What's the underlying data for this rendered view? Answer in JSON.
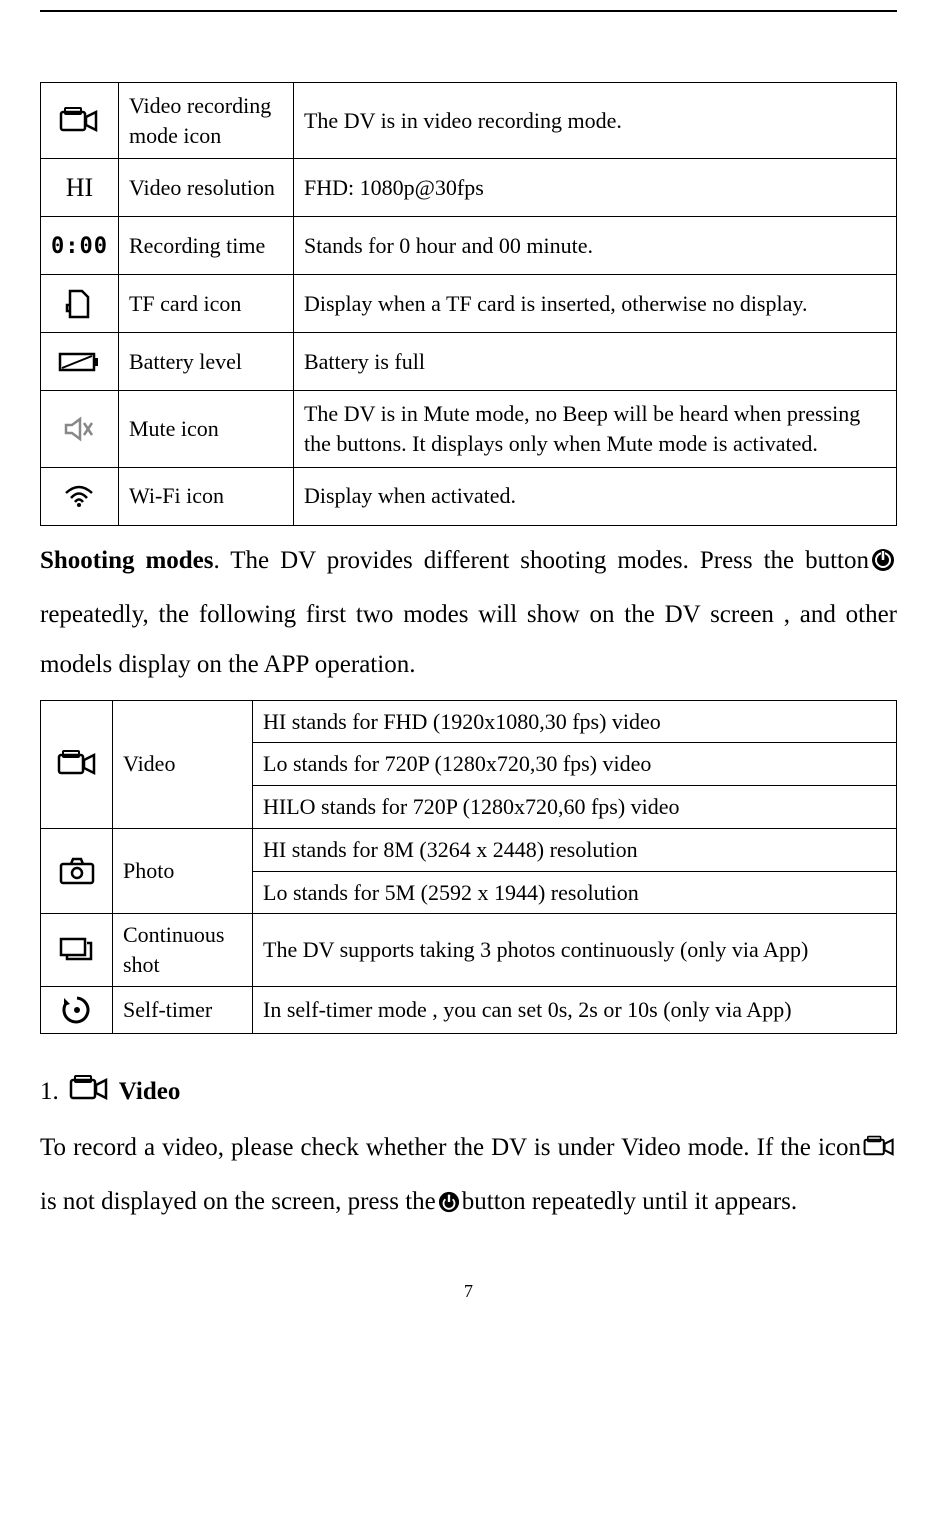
{
  "icons_table": {
    "rows": [
      {
        "name": "Video recording mode icon",
        "desc": "The DV is in video recording mode."
      },
      {
        "glyph": "HI",
        "name": "Video resolution",
        "desc": "FHD: 1080p@30fps"
      },
      {
        "glyph": "0:00",
        "name": "Recording time",
        "desc": "Stands for 0 hour and 00 minute."
      },
      {
        "name": "TF card icon",
        "desc": "Display when a TF card is inserted, otherwise no display."
      },
      {
        "name": "Battery level",
        "desc": "Battery is full"
      },
      {
        "name": "Mute icon",
        "desc": "The DV is in Mute mode, no Beep will be heard when pressing the buttons. It displays only when Mute mode is activated."
      },
      {
        "name": "Wi-Fi icon",
        "desc": "Display when activated."
      }
    ]
  },
  "shooting_modes_intro": {
    "prefix_bold": "Shooting modes",
    "part1": ". The DV provides different shooting modes. Press the button",
    "part2": " repeatedly, the following first two modes will show on the DV screen , and other models display on the APP operation."
  },
  "modes_table": {
    "video": {
      "label": "Video",
      "lines": [
        "HI stands for FHD (1920x1080,30 fps) video",
        "Lo stands for 720P (1280x720,30 fps) video",
        "HILO stands for 720P (1280x720,60 fps) video"
      ]
    },
    "photo": {
      "label": "Photo",
      "lines": [
        "HI stands for 8M (3264 x 2448) resolution",
        "Lo stands for 5M (2592 x 1944) resolution"
      ]
    },
    "continuous": {
      "label": "Continuous shot",
      "desc": "The DV supports taking 3 photos continuously (only via App)"
    },
    "selftimer": {
      "label": "Self-timer",
      "desc": "In self-timer mode , you can set 0s, 2s or 10s (only via App)"
    }
  },
  "video_section": {
    "num": "1.",
    "label": "Video",
    "body_part1": "To record a video, please check whether the DV is under Video mode. If the icon",
    "body_part2": " is not displayed on the screen, press the",
    "body_part3": "button repeatedly until it appears."
  },
  "page_number": "7"
}
